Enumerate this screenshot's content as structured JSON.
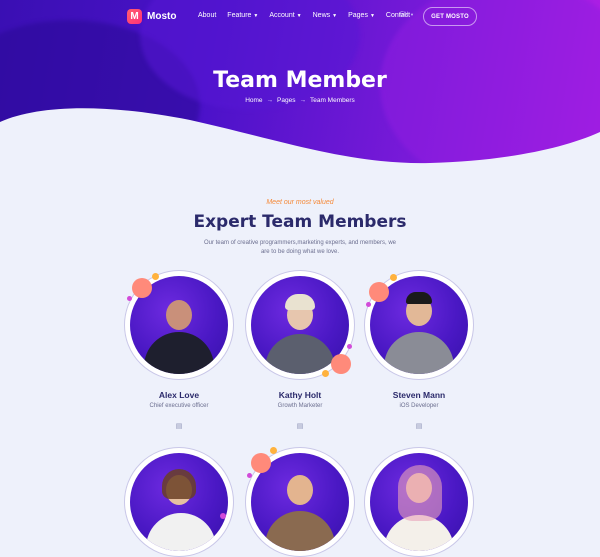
{
  "header": {
    "brand": "Mosto",
    "nav": [
      {
        "label": "About",
        "caret": false
      },
      {
        "label": "Feature",
        "caret": true
      },
      {
        "label": "Account",
        "caret": true
      },
      {
        "label": "News",
        "caret": true
      },
      {
        "label": "Pages",
        "caret": true
      },
      {
        "label": "Contact",
        "caret": false
      }
    ],
    "lang": "EN",
    "cta": "GET MOSTO"
  },
  "hero": {
    "title": "Team Member",
    "breadcrumb": [
      "Home",
      "Pages",
      "Team Members"
    ]
  },
  "section": {
    "eyebrow": "Meet our most valued",
    "title": "Expert Team Members",
    "description": "Our team of creative programmers,marketing experts, and members, we are to be doing what we love."
  },
  "members": [
    {
      "name": "Alex Love",
      "role": "Chief executive officer",
      "social_icon": "linkedin-icon"
    },
    {
      "name": "Kathy Holt",
      "role": "Growth Marketer",
      "social_icon": "linkedin-icon"
    },
    {
      "name": "Steven Mann",
      "role": "iOS Developer",
      "social_icon": "linkedin-icon"
    },
    {
      "name": "",
      "role": "",
      "social_icon": ""
    },
    {
      "name": "",
      "role": "",
      "social_icon": ""
    },
    {
      "name": "",
      "role": "",
      "social_icon": ""
    }
  ],
  "colors": {
    "hero_start": "#3a0fb3",
    "hero_end": "#b51fe6",
    "title_dark": "#2b2a6b",
    "accent_orange": "#f58a3a",
    "page_bg": "#eef1fb"
  }
}
